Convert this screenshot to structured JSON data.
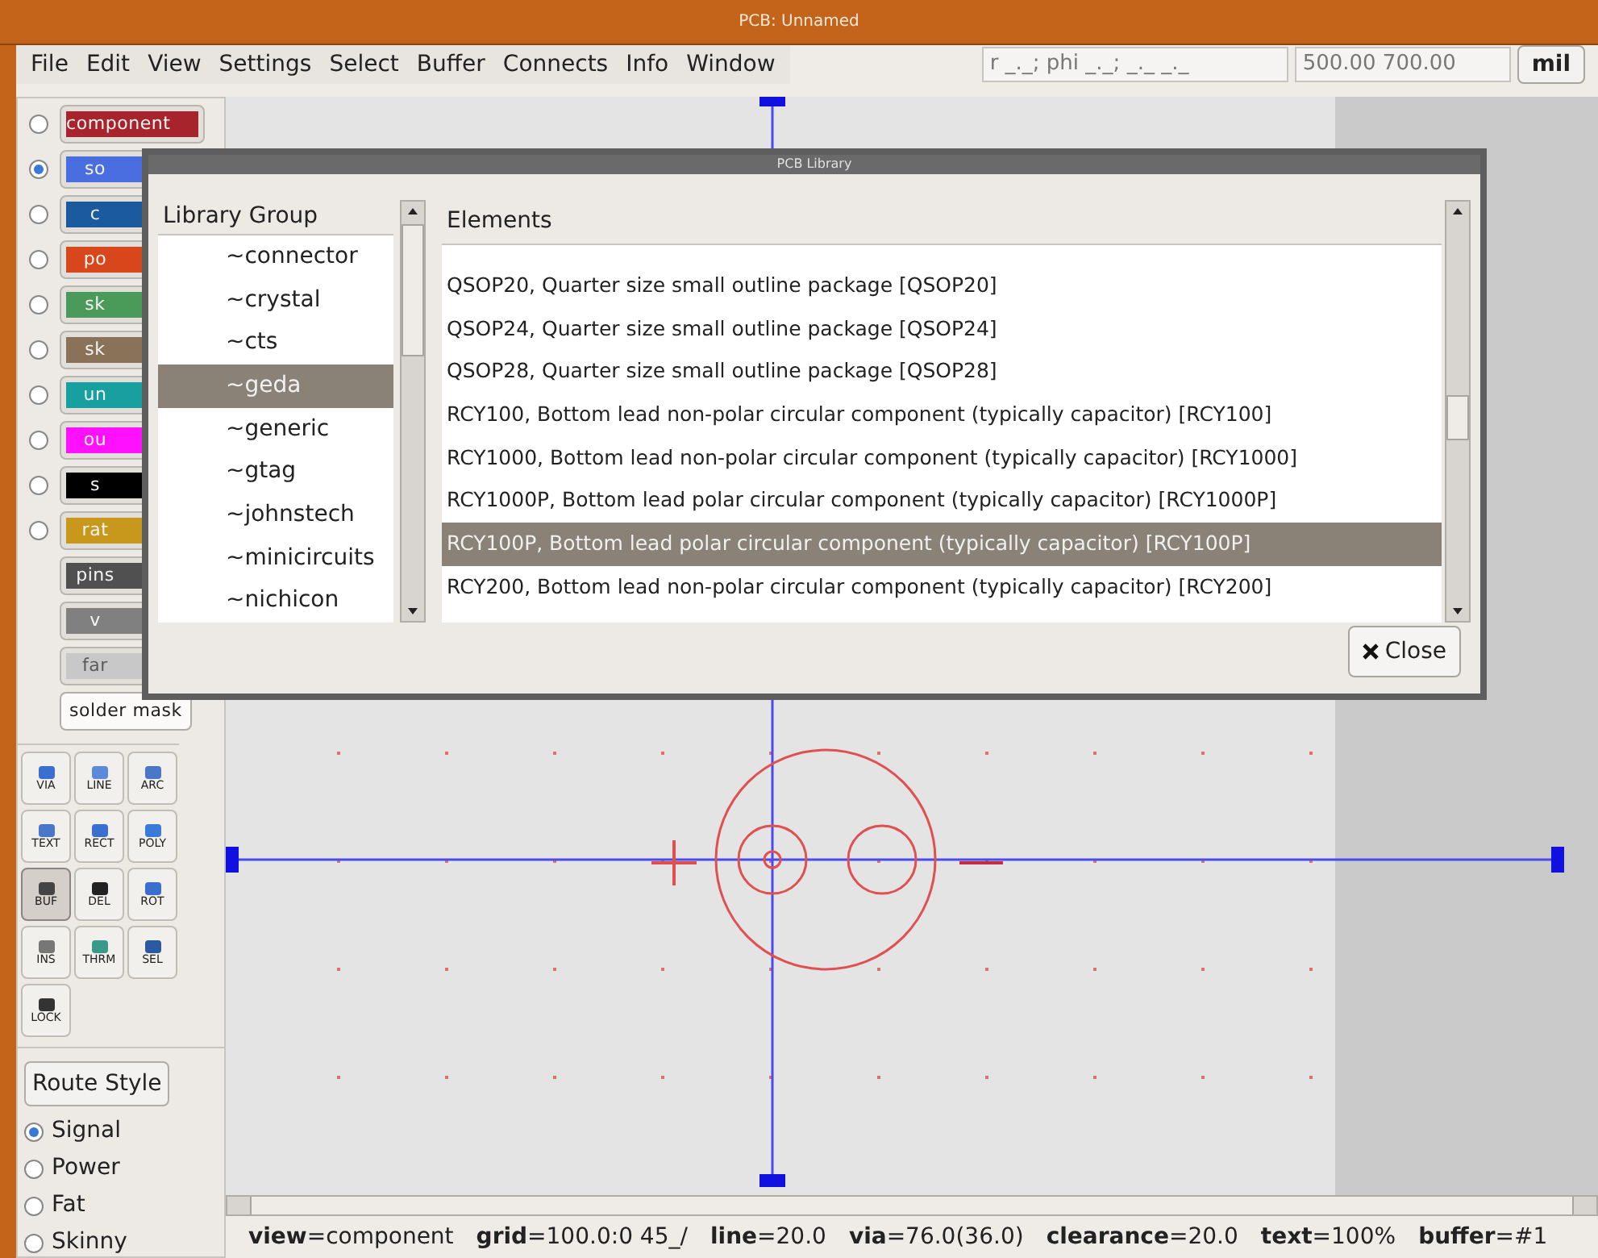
{
  "window": {
    "title": "PCB: Unnamed"
  },
  "menu": [
    "File",
    "Edit",
    "View",
    "Settings",
    "Select",
    "Buffer",
    "Connects",
    "Info",
    "Window"
  ],
  "coords": {
    "polar": "r _._; phi _._; _._ _._",
    "position": "500.00 700.00",
    "units": "mil"
  },
  "layers": [
    {
      "label": "component",
      "color": "#a8242c",
      "visible": false,
      "kind": "layer"
    },
    {
      "label": "so",
      "color": "#4a6ee0",
      "visible": true,
      "kind": "layer"
    },
    {
      "label": "c",
      "color": "#1c5aa0",
      "visible": false,
      "kind": "layer"
    },
    {
      "label": "po",
      "color": "#d8461c",
      "visible": false,
      "kind": "layer"
    },
    {
      "label": "sk",
      "color": "#4a9a5a",
      "visible": false,
      "kind": "layer"
    },
    {
      "label": "sk",
      "color": "#8a7258",
      "visible": false,
      "kind": "layer"
    },
    {
      "label": "un",
      "color": "#18a0a0",
      "visible": false,
      "kind": "layer"
    },
    {
      "label": "ou",
      "color": "#ff10ff",
      "visible": false,
      "kind": "layer"
    },
    {
      "label": "s",
      "color": "#000000",
      "visible": false,
      "kind": "layer"
    },
    {
      "label": "rat",
      "color": "#c8981c",
      "visible": false,
      "kind": "layer"
    },
    {
      "label": "pins",
      "color": "#505050",
      "kind": "plain"
    },
    {
      "label": "v",
      "color": "#808080",
      "kind": "plain"
    },
    {
      "label": "far",
      "color": "#c8c8c8",
      "kind": "plain"
    },
    {
      "label": "solder mask",
      "kind": "toggle"
    }
  ],
  "tools": [
    {
      "label": "VIA",
      "selected": false
    },
    {
      "label": "LINE",
      "selected": false
    },
    {
      "label": "ARC",
      "selected": false
    },
    {
      "label": "TEXT",
      "selected": false
    },
    {
      "label": "RECT",
      "selected": false
    },
    {
      "label": "POLY",
      "selected": false
    },
    {
      "label": "BUF",
      "selected": true
    },
    {
      "label": "DEL",
      "selected": false
    },
    {
      "label": "ROT",
      "selected": false
    },
    {
      "label": "INS",
      "selected": false
    },
    {
      "label": "THRM",
      "selected": false
    },
    {
      "label": "SEL",
      "selected": false
    },
    {
      "label": "LOCK",
      "selected": false
    }
  ],
  "route_style": {
    "button": "Route Style",
    "options": [
      {
        "label": "Signal",
        "selected": true
      },
      {
        "label": "Power",
        "selected": false
      },
      {
        "label": "Fat",
        "selected": false
      },
      {
        "label": "Skinny",
        "selected": false
      }
    ]
  },
  "status_bar": [
    {
      "key": "view",
      "value": "=component"
    },
    {
      "key": "grid",
      "value": "=100.0:0  45_/"
    },
    {
      "key": "line",
      "value": "=20.0"
    },
    {
      "key": "via",
      "value": "=76.0(36.0)"
    },
    {
      "key": "clearance",
      "value": "=20.0"
    },
    {
      "key": "text",
      "value": "=100%"
    },
    {
      "key": "buffer",
      "value": "=#1"
    }
  ],
  "dialog": {
    "title": "PCB Library",
    "groups_header": "Library Group",
    "groups": [
      {
        "label": "~connector",
        "selected": false
      },
      {
        "label": "~crystal",
        "selected": false
      },
      {
        "label": "~cts",
        "selected": false
      },
      {
        "label": "~geda",
        "selected": true
      },
      {
        "label": "~generic",
        "selected": false
      },
      {
        "label": "~gtag",
        "selected": false
      },
      {
        "label": "~johnstech",
        "selected": false
      },
      {
        "label": "~minicircuits",
        "selected": false
      },
      {
        "label": "~nichicon",
        "selected": false
      }
    ],
    "elements_header": "Elements",
    "elements": [
      {
        "label": "QSOP20, Quarter size small outline package [QSOP20]",
        "selected": false
      },
      {
        "label": "QSOP24, Quarter size small outline package [QSOP24]",
        "selected": false
      },
      {
        "label": "QSOP28, Quarter size small outline package [QSOP28]",
        "selected": false
      },
      {
        "label": "RCY100, Bottom lead non-polar circular component (typically capacitor) [RCY100]",
        "selected": false
      },
      {
        "label": "RCY1000, Bottom lead non-polar circular component (typically capacitor) [RCY1000]",
        "selected": false
      },
      {
        "label": "RCY1000P, Bottom lead polar circular component (typically capacitor) [RCY1000P]",
        "selected": false
      },
      {
        "label": "RCY100P, Bottom lead polar circular component (typically capacitor) [RCY100P]",
        "selected": true
      },
      {
        "label": "RCY200, Bottom lead non-polar circular component (typically capacitor) [RCY200]",
        "selected": false
      }
    ],
    "close": "Close"
  }
}
